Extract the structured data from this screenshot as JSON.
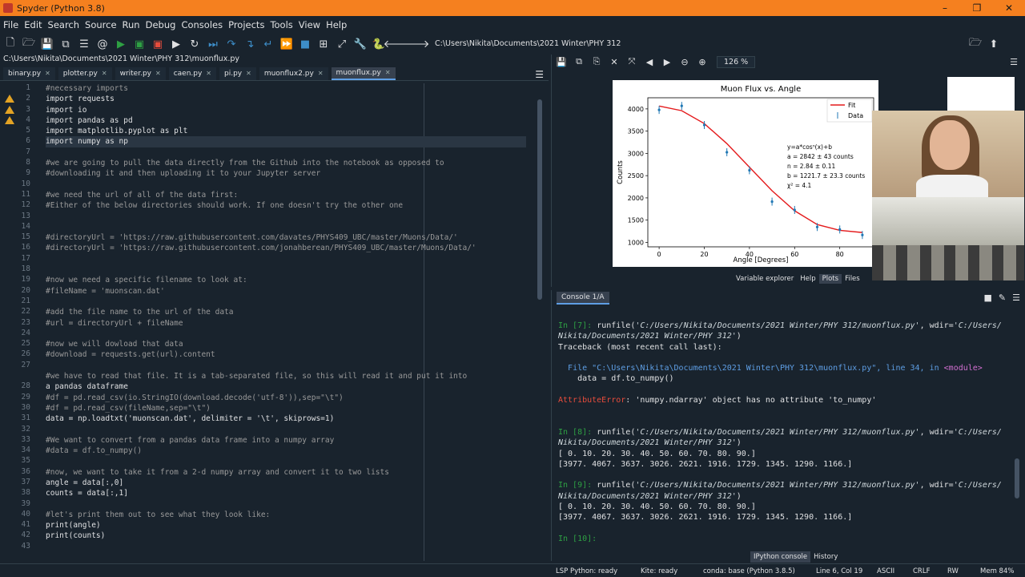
{
  "window": {
    "title": "Spyder (Python 3.8)"
  },
  "menu": [
    "File",
    "Edit",
    "Search",
    "Source",
    "Run",
    "Debug",
    "Consoles",
    "Projects",
    "Tools",
    "View",
    "Help"
  ],
  "toolbar": {
    "path": "C:\\Users\\Nikita\\Documents\\2021 Winter\\PHY 312"
  },
  "editor": {
    "file_path": "C:\\Users\\Nikita\\Documents\\2021 Winter\\PHY 312\\muonflux.py",
    "tabs": [
      "binary.py",
      "plotter.py",
      "writer.py",
      "caen.py",
      "pi.py",
      "muonflux2.py",
      "muonflux.py"
    ],
    "active_tab": "muonflux.py",
    "lines": [
      "#necessary imports",
      "import requests",
      "import io",
      "import pandas as pd",
      "import matplotlib.pyplot as plt",
      "import numpy as np",
      "",
      "#we are going to pull the data directly from the Github into the notebook as opposed to",
      "#downloading it and then uploading it to your Jupyter server",
      "",
      "#we need the url of all of the data first:",
      "#Either of the below directories should work. If one doesn't try the other one",
      "",
      "",
      "#directoryUrl = 'https://raw.githubusercontent.com/davates/PHYS409_UBC/master/Muons/Data/'",
      "#directoryUrl = 'https://raw.githubusercontent.com/jonahberean/PHYS409_UBC/master/Muons/Data/'",
      "",
      "",
      "#now we need a specific filename to look at:",
      "#fileName = 'muonscan.dat'",
      "",
      "#add the file name to the url of the data",
      "#url = directoryUrl + fileName",
      "",
      "#now we will dowload that data",
      "#download = requests.get(url).content",
      "",
      "#we have to read that file. It is a tab-separated file, so this will read it and put it into",
      "a pandas dataframe",
      "#df = pd.read_csv(io.StringIO(download.decode('utf-8')),sep=\"\\t\")",
      "#df = pd.read_csv(fileName,sep=\"\\t\")",
      "data = np.loadtxt('muonscan.dat', delimiter = '\\t', skiprows=1)",
      "",
      "#We want to convert from a pandas data frame into a numpy array",
      "#data = df.to_numpy()",
      "",
      "#now, we want to take it from a 2-d numpy array and convert it to two lists",
      "angle = data[:,0]",
      "counts = data[:,1]",
      "",
      "#let's print them out to see what they look like:",
      "print(angle)",
      "print(counts)",
      ""
    ],
    "line_numbers": [
      "1",
      "2",
      "3",
      "4",
      "5",
      "6",
      "7",
      "8",
      "9",
      "10",
      "11",
      "12",
      "13",
      "14",
      "15",
      "16",
      "17",
      "18",
      "19",
      "20",
      "21",
      "22",
      "23",
      "24",
      "25",
      "26",
      "27",
      "",
      "28",
      "29",
      "30",
      "31",
      "32",
      "33",
      "34",
      "35",
      "36",
      "37",
      "38",
      "39",
      "40",
      "41",
      "42",
      "43"
    ]
  },
  "plots": {
    "zoom": "126 %",
    "pane_tabs": [
      "Variable explorer",
      "Help",
      "Plots",
      "Files"
    ],
    "active_pane_tab": "Plots"
  },
  "chart_data": {
    "type": "scatter",
    "title": "Muon Flux vs. Angle",
    "xlabel": "Angle [Degrees]",
    "ylabel": "Counts",
    "xlim": [
      -5,
      95
    ],
    "ylim": [
      900,
      4250
    ],
    "xticks": [
      "0",
      "20",
      "40",
      "60",
      "80"
    ],
    "yticks": [
      "1000",
      "1500",
      "2000",
      "2500",
      "3000",
      "3500",
      "4000"
    ],
    "series": [
      {
        "name": "Fit",
        "kind": "line",
        "color": "#e41a1c",
        "x": [
          0,
          10,
          20,
          30,
          40,
          50,
          60,
          70,
          80,
          90
        ],
        "y": [
          4064,
          3960,
          3670,
          3220,
          2690,
          2160,
          1710,
          1400,
          1270,
          1222
        ]
      },
      {
        "name": "Data",
        "kind": "errorbar",
        "color": "#1f77b4",
        "x": [
          0,
          10,
          20,
          30,
          40,
          50,
          60,
          70,
          80,
          90
        ],
        "y": [
          3977,
          4067,
          3637,
          3026,
          2621,
          1916,
          1729,
          1345,
          1290,
          1166
        ]
      }
    ],
    "legend_position": "top-right",
    "annotation": [
      "y=a*cosⁿ(x)+b",
      "a = 2842 ± 43 counts",
      "n = 2.84 ± 0.11",
      "b = 1221.7 ± 23.3 counts",
      "χ² = 4.1"
    ]
  },
  "console": {
    "tab": "Console 1/A",
    "bottom_tabs": [
      "IPython console",
      "History"
    ],
    "active_bottom_tab": "IPython console"
  },
  "status": {
    "lsp": "LSP Python: ready",
    "kite": "Kite: ready",
    "conda": "conda: base (Python 3.8.5)",
    "position": "Line 6, Col 19",
    "encoding": "ASCII",
    "eol": "CRLF",
    "perm": "RW",
    "mem": "Mem 84%"
  }
}
